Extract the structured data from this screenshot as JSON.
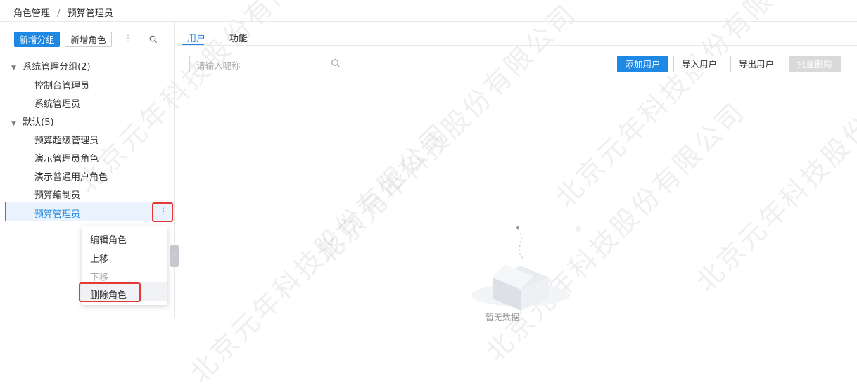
{
  "breadcrumb": {
    "parent": "角色管理",
    "separator": "/",
    "current": "预算管理员"
  },
  "left": {
    "add_group": "新增分组",
    "add_role": "新增角色",
    "tree": [
      {
        "label": "系统管理分组(2)",
        "expanded": true,
        "children": [
          "控制台管理员",
          "系统管理员"
        ]
      },
      {
        "label": "默认(5)",
        "expanded": true,
        "children": [
          "预算超级管理员",
          "演示管理员角色",
          "演示普通用户角色",
          "预算编制员",
          "预算管理员"
        ]
      }
    ],
    "selected": "预算管理员"
  },
  "context_menu": {
    "items": [
      {
        "label": "编辑角色",
        "disabled": false
      },
      {
        "label": "上移",
        "disabled": false
      },
      {
        "label": "下移",
        "disabled": true
      },
      {
        "label": "删除角色",
        "disabled": false
      }
    ]
  },
  "tabs": [
    {
      "label": "用户",
      "active": true
    },
    {
      "label": "功能",
      "active": false
    }
  ],
  "toolbar": {
    "search_placeholder": "请输入昵称",
    "add_user": "添加用户",
    "import_user": "导入用户",
    "export_user": "导出用户",
    "batch_delete": "批量删除"
  },
  "empty": {
    "text": "暂无数据"
  },
  "watermark": {
    "text": "北京元年科技股份有限公司"
  },
  "colors": {
    "primary": "#1e88e5",
    "highlight": "#e53935",
    "selected_bg": "#eaf3fd"
  }
}
